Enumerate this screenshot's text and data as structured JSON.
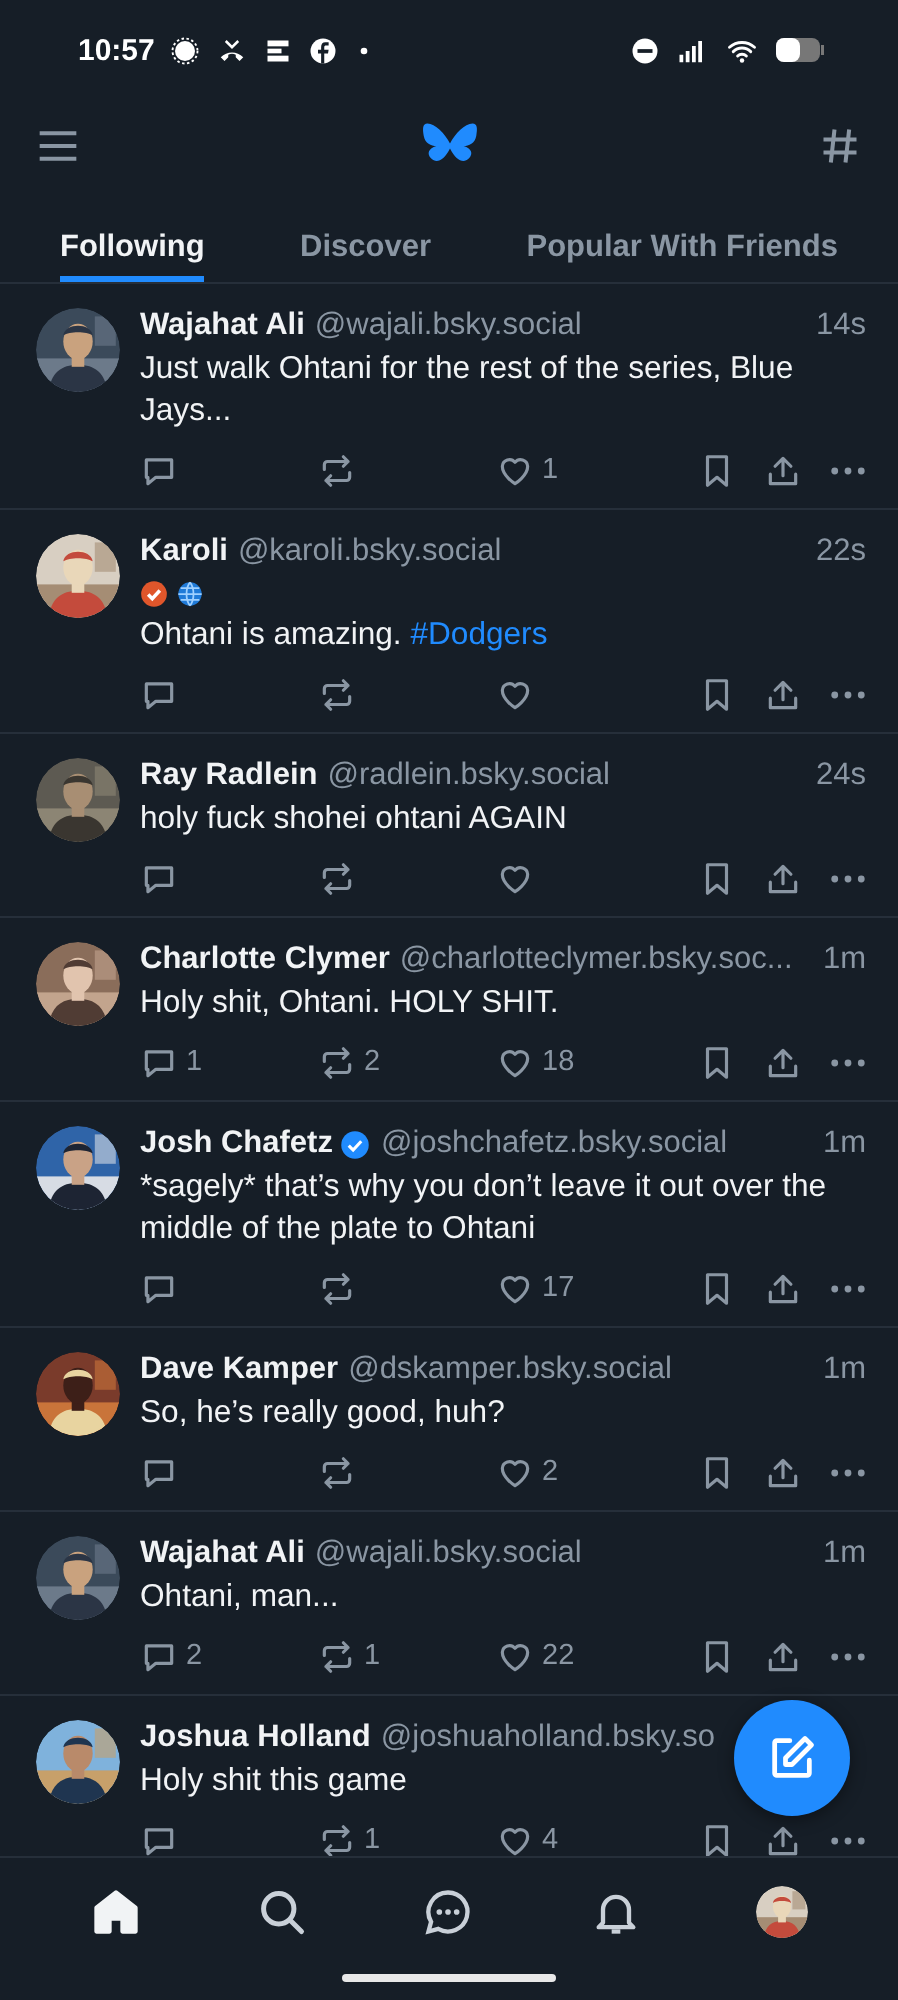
{
  "status_bar": {
    "time": "10:57"
  },
  "tabs": [
    {
      "label": "Following",
      "selected": true
    },
    {
      "label": "Discover",
      "selected": false
    },
    {
      "label": "Popular With Friends",
      "selected": false
    }
  ],
  "posts": [
    {
      "name": "Wajahat Ali",
      "verified": false,
      "handle": "@wajali.bsky.social",
      "time": "14s",
      "text": "Just walk Ohtani for the rest of the series, Blue Jays...",
      "likes": "1"
    },
    {
      "name": "Karoli",
      "verified": false,
      "handle": "@karoli.bsky.social",
      "time": "22s",
      "badges": [
        {
          "kind": "check"
        },
        {
          "kind": "globe"
        }
      ],
      "text": "Ohtani is amazing.",
      "hashtag": "#Dodgers"
    },
    {
      "name": "Ray Radlein",
      "verified": false,
      "handle": "@radlein.bsky.social",
      "time": "24s",
      "text": "holy fuck shohei ohtani AGAIN"
    },
    {
      "name": "Charlotte Clymer",
      "verified": false,
      "handle": "@charlotteclymer.bsky.soc...",
      "time": "1m",
      "text": "Holy shit, Ohtani. HOLY SHIT.",
      "replies": "1",
      "reposts": "2",
      "likes": "18"
    },
    {
      "name": "Josh Chafetz",
      "verified": true,
      "handle": "@joshchafetz.bsky.social",
      "time": "1m",
      "text": "*sagely* that’s why you don’t leave it out over the middle of the plate to Ohtani",
      "likes": "17"
    },
    {
      "name": "Dave Kamper",
      "verified": false,
      "handle": "@dskamper.bsky.social",
      "time": "1m",
      "text": "So, he’s really good, huh?",
      "likes": "2"
    },
    {
      "name": "Wajahat Ali",
      "verified": false,
      "handle": "@wajali.bsky.social",
      "time": "1m",
      "text": "Ohtani, man...",
      "replies": "2",
      "reposts": "1",
      "likes": "22"
    },
    {
      "name": "Joshua Holland",
      "verified": false,
      "handle": "@joshuaholland.bsky.so",
      "text": "Holy shit this game",
      "reposts": "1",
      "likes": "4"
    }
  ],
  "bottom_nav": [
    {
      "kind": "home",
      "selected": true
    },
    {
      "kind": "search",
      "selected": false
    },
    {
      "kind": "chat",
      "selected": false
    },
    {
      "kind": "bell",
      "selected": false
    },
    {
      "kind": "avatar",
      "selected": false
    }
  ]
}
